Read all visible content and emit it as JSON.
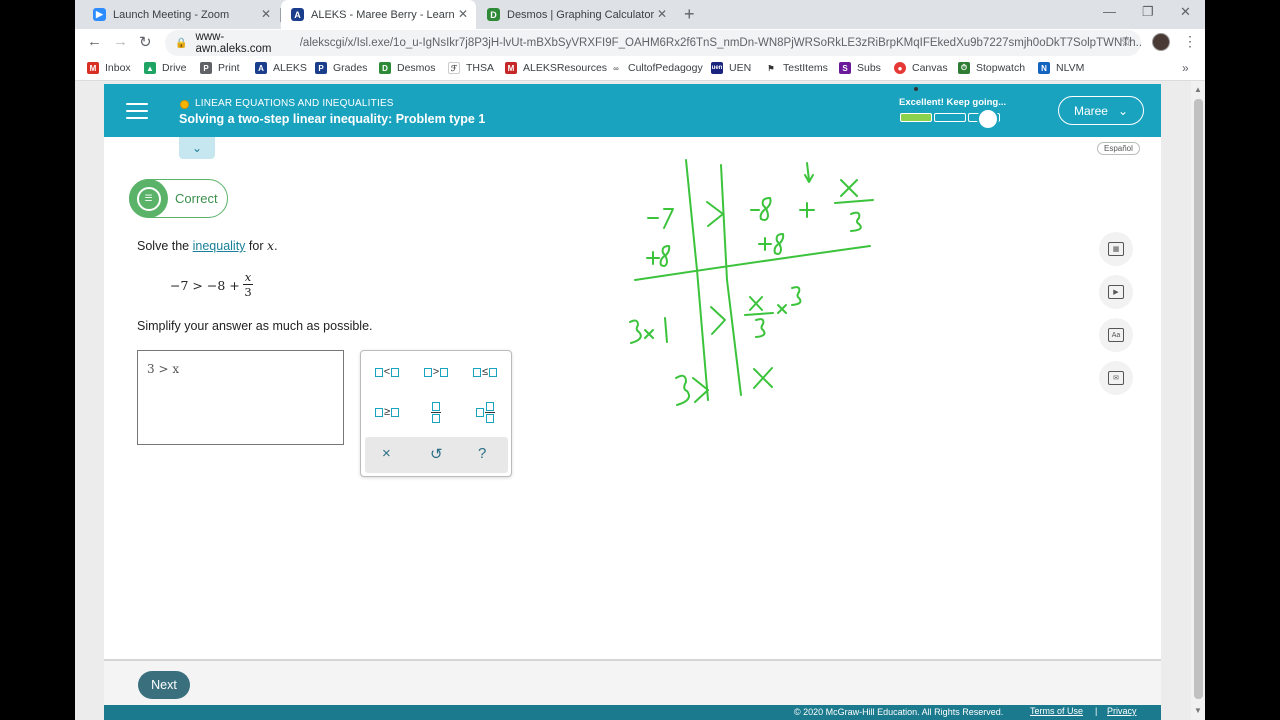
{
  "tabs": [
    {
      "title": "Launch Meeting - Zoom",
      "icon": "zoom-icon",
      "color": "#2d8cff"
    },
    {
      "title": "ALEKS - Maree Berry - Learn",
      "icon": "aleks-icon",
      "color": "#1a3e8c"
    },
    {
      "title": "Desmos | Graphing Calculator",
      "icon": "desmos-icon",
      "color": "#2f8a38"
    }
  ],
  "address": {
    "host": "www-awn.aleks.com",
    "path": "/alekscgi/x/Isl.exe/1o_u-IgNsIkr7j8P3jH-lvUt-mBXbSyVRXFI9F_OAHM6Rx2f6TnS_nmDn-WN8PjWRSoRkLE3zRiBrpKMqIFEkedXu9b7227smjh0oDkT7SolpTWNTh..."
  },
  "bookmarks": [
    {
      "label": "Inbox",
      "color": "#d93025"
    },
    {
      "label": "Drive",
      "color": "#1fa463"
    },
    {
      "label": "Print",
      "color": "#5f6368"
    },
    {
      "label": "ALEKS",
      "color": "#1a3e8c"
    },
    {
      "label": "Grades",
      "color": "#1a3e8c"
    },
    {
      "label": "Desmos",
      "color": "#2f8a38"
    },
    {
      "label": "THSA",
      "color": "#555555"
    },
    {
      "label": "ALEKSResources",
      "color": "#c62828"
    },
    {
      "label": "CultofPedagogy",
      "color": "#777777"
    },
    {
      "label": "UEN",
      "color": "#1a237e"
    },
    {
      "label": "TestItems",
      "color": "#333333"
    },
    {
      "label": "Subs",
      "color": "#6a1b9a"
    },
    {
      "label": "Canvas",
      "color": "#e53935"
    },
    {
      "label": "Stopwatch",
      "color": "#2e7d32"
    },
    {
      "label": "NLVM",
      "color": "#1565c0"
    }
  ],
  "header": {
    "topic": "LINEAR EQUATIONS AND INEQUALITIES",
    "problem_title": "Solving a two-step linear inequality: Problem type 1",
    "progress_label": "Excellent! Keep going...",
    "progress_filled_segments": 1,
    "progress_total_segments": 3,
    "user_name": "Maree",
    "espanol": "Español"
  },
  "problem": {
    "status": "Correct",
    "prompt_prefix": "Solve the",
    "prompt_link": "inequality",
    "prompt_suffix": "for",
    "prompt_var": "x",
    "prompt_end": ".",
    "equation_lhs": "−7 > −8 +",
    "fraction_num": "x",
    "fraction_den": "3",
    "instruction": "Simplify your answer as much as possible.",
    "answer": "3 > x"
  },
  "keypad": {
    "keys": [
      "<",
      ">",
      "≤",
      "≥",
      "fraction",
      "mixed-number"
    ],
    "actions": [
      "×",
      "↺",
      "?"
    ]
  },
  "handwriting": {
    "lines": [
      "−7 > −8 + x/3",
      "+8     +8",
      "3 × 1 > x/3 × 3",
      "3 > x"
    ]
  },
  "footer": {
    "next_label": "Next",
    "copyright": "© 2020 McGraw-Hill Education. All Rights Reserved.",
    "terms": "Terms of Use",
    "separator": "|",
    "privacy": "Privacy"
  },
  "colors": {
    "header_teal": "#1aa3bf",
    "correct_green": "#5bb36a",
    "ink_green": "#3cc33c",
    "next_button": "#3a6f7d"
  }
}
